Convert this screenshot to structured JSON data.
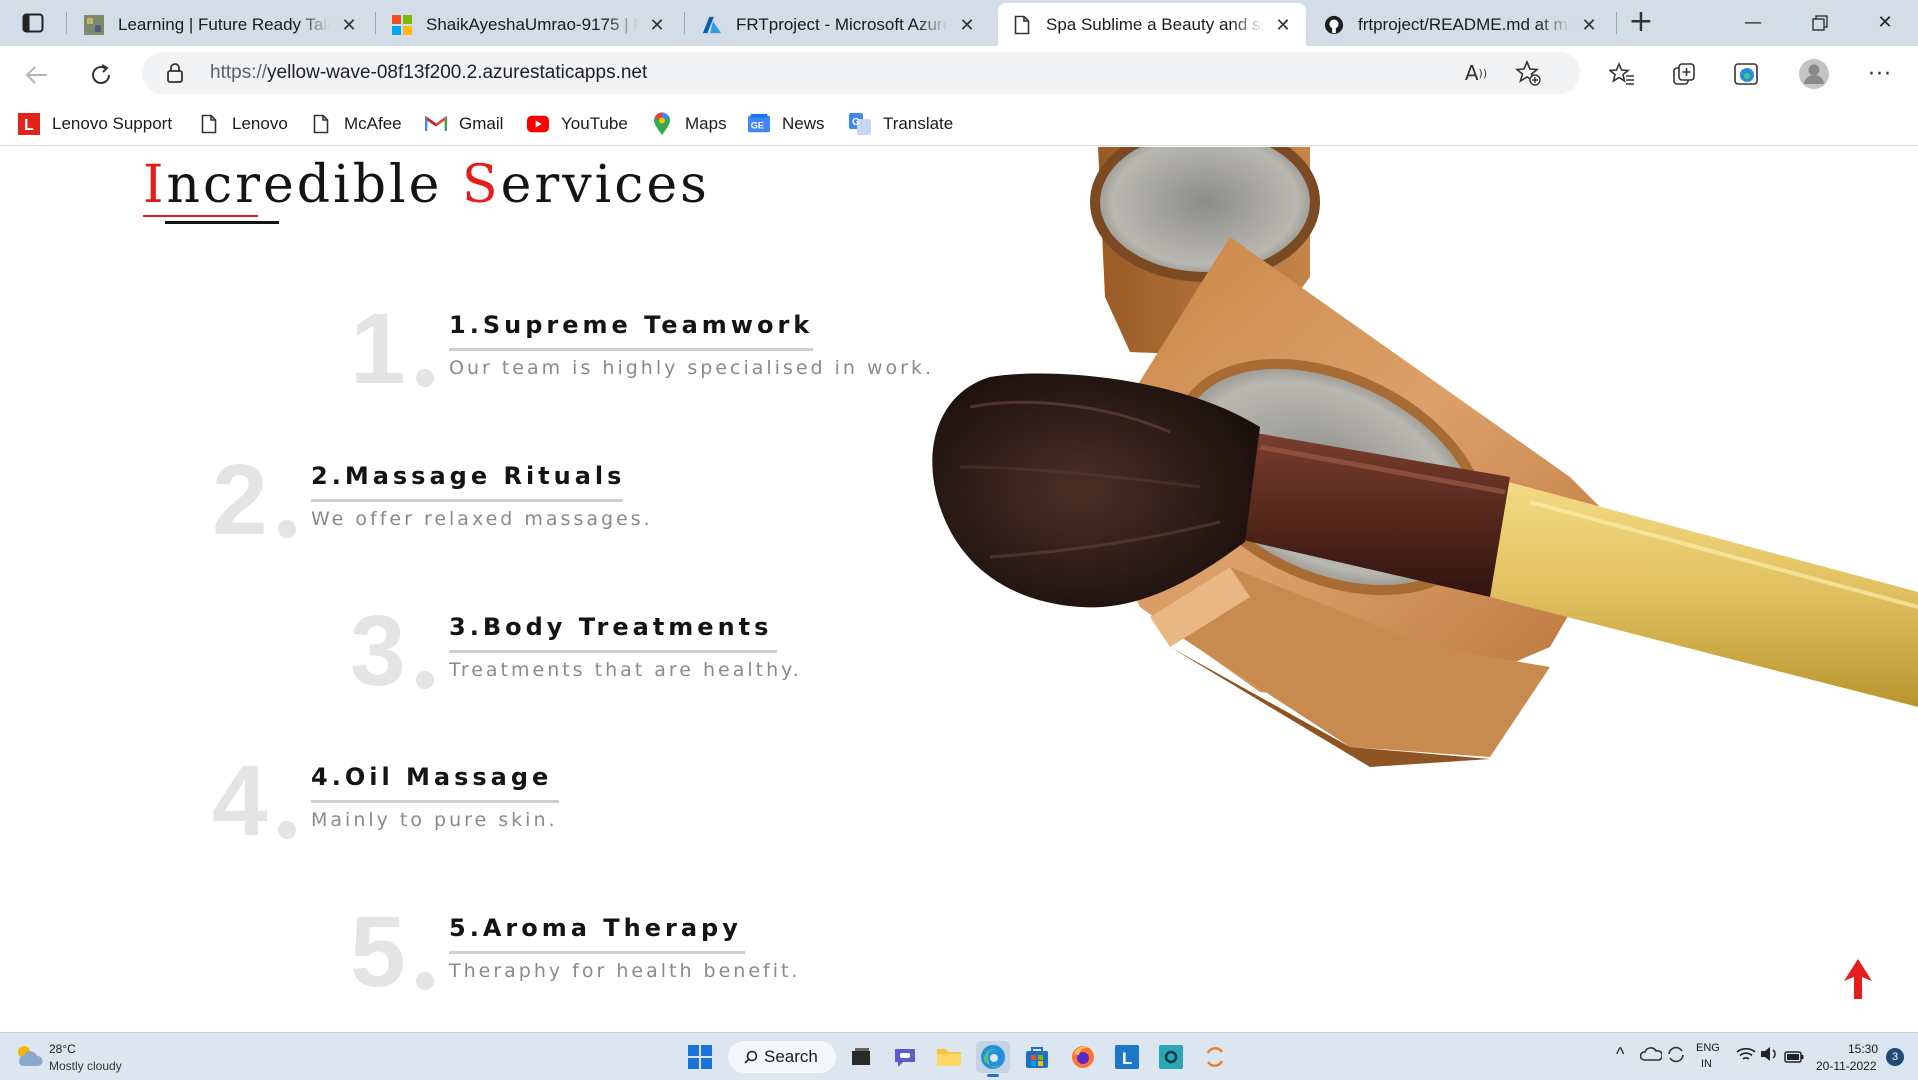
{
  "browser": {
    "tabs": [
      {
        "title": "Learning | Future Ready Talent",
        "icon": "frt-icon",
        "active": false
      },
      {
        "title": "ShaikAyeshaUmrao-9175 | Microsoft",
        "icon": "microsoft-icon",
        "active": false
      },
      {
        "title": "FRTproject - Microsoft Azure",
        "icon": "azure-icon",
        "active": false
      },
      {
        "title": "Spa Sublime a Beauty and spa",
        "icon": "page-icon",
        "active": true
      },
      {
        "title": "frtproject/README.md at main",
        "icon": "github-icon",
        "active": false
      }
    ],
    "url_scheme": "https://",
    "url_host": "yellow-wave-08f13f200.2.azurestaticapps.net",
    "bookmarks": [
      {
        "label": "Lenovo Support",
        "icon": "lenovo-icon"
      },
      {
        "label": "Lenovo",
        "icon": "page-icon"
      },
      {
        "label": "McAfee",
        "icon": "page-icon"
      },
      {
        "label": "Gmail",
        "icon": "gmail-icon"
      },
      {
        "label": "YouTube",
        "icon": "youtube-icon"
      },
      {
        "label": "Maps",
        "icon": "maps-icon"
      },
      {
        "label": "News",
        "icon": "news-icon"
      },
      {
        "label": "Translate",
        "icon": "translate-icon"
      }
    ]
  },
  "page": {
    "heading_part1_initial": "I",
    "heading_part1_rest": "ncredible ",
    "heading_part2_initial": "S",
    "heading_part2_rest": "ervices",
    "services": [
      {
        "num": "1",
        "title": "1.Supreme Teamwork",
        "desc": "Our team is highly specialised in work."
      },
      {
        "num": "2",
        "title": "2.Massage Rituals",
        "desc": "We offer relaxed massages."
      },
      {
        "num": "3",
        "title": "3.Body Treatments",
        "desc": "Treatments that are healthy."
      },
      {
        "num": "4",
        "title": "4.Oil Massage",
        "desc": "Mainly to pure skin."
      },
      {
        "num": "5",
        "title": "5.Aroma Therapy",
        "desc": "Theraphy for health benefit."
      }
    ]
  },
  "taskbar": {
    "weather_temp": "28°C",
    "weather_desc": "Mostly cloudy",
    "search_label": "Search",
    "lang_top": "ENG",
    "lang_bottom": "IN",
    "time": "15:30",
    "date": "20-11-2022",
    "notification_count": "3"
  },
  "colors": {
    "accent_red": "#e31d1d",
    "numeral_gray": "#e4e4e4",
    "taskbar": "#dbe6f1"
  }
}
